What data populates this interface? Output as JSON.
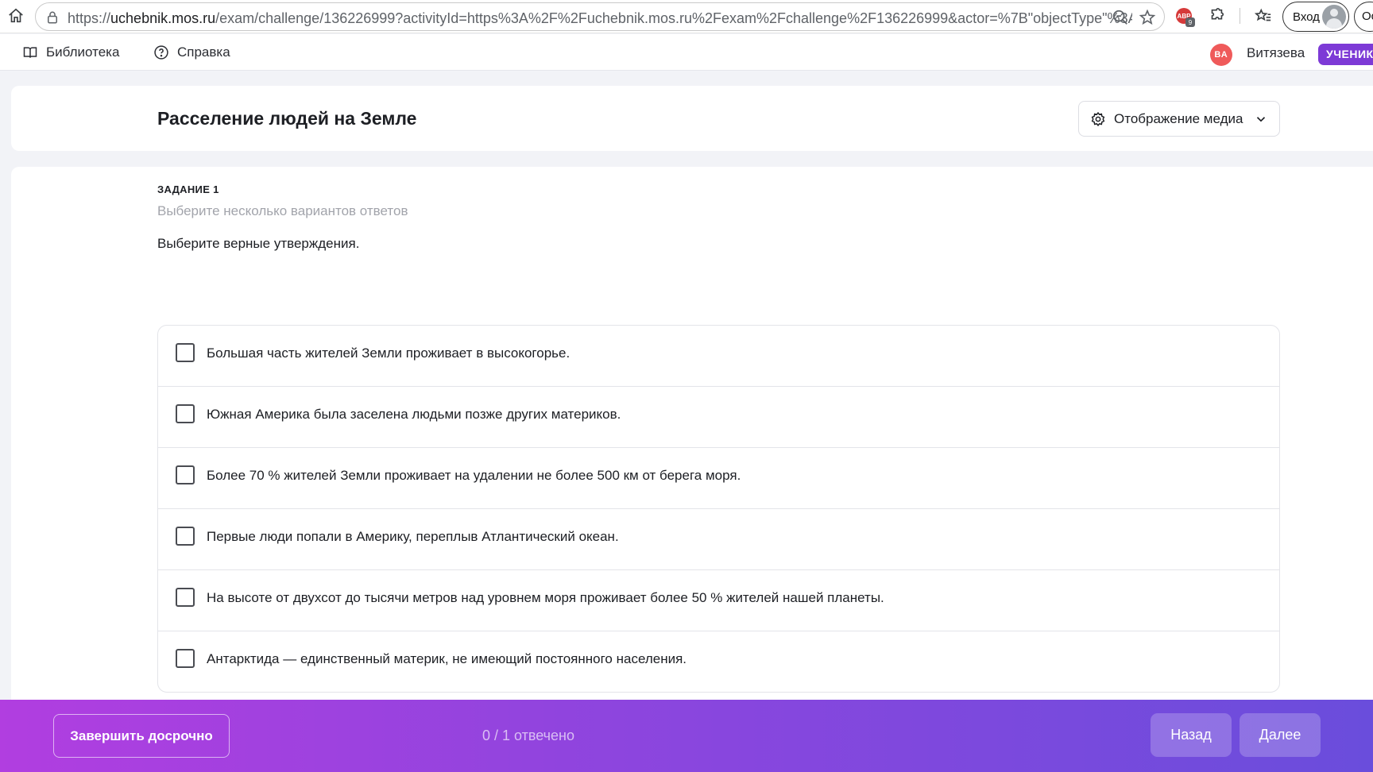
{
  "browser": {
    "url_prefix": "https://",
    "url_host": "uchebnik.mos.ru",
    "url_rest": "/exam/challenge/136226999?activityId=https%3A%2F%2Fuchebnik.mos.ru%2Fexam%2Fchallenge%2F136226999&actor=%7B\"objectType\"%3A...",
    "extension_badge_text": "ABP",
    "extension_badge_count": "9",
    "login_label": "Вход",
    "extra_label": "Ос"
  },
  "nav": {
    "library_label": "Библиотека",
    "help_label": "Справка",
    "user_initials": "ВА",
    "user_name": "Витязева",
    "role_badge": "УЧЕНИК"
  },
  "header": {
    "title": "Расселение людей на Земле",
    "media_button_label": "Отображение медиа"
  },
  "task": {
    "number_label": "ЗАДАНИЕ 1",
    "hint": "Выберите несколько вариантов ответов",
    "question": "Выберите верные утверждения.",
    "options": [
      {
        "label": "Большая часть жителей Земли проживает в высокогорье.",
        "checked": false
      },
      {
        "label": "Южная Америка была заселена людьми позже других материков.",
        "checked": false
      },
      {
        "label": "Более 70 % жителей Земли проживает на удалении не более 500 км от берега моря.",
        "checked": false
      },
      {
        "label": "Первые люди попали в Америку, переплыв Атлантический океан.",
        "checked": false
      },
      {
        "label": "На высоте от двухсот до тысячи метров над уровнем моря проживает более 50 % жителей нашей планеты.",
        "checked": false
      },
      {
        "label": "Антарктида — единственный материк, не имеющий постоянного населения.",
        "checked": false
      }
    ]
  },
  "footer": {
    "finish_label": "Завершить досрочно",
    "progress_text": "0 / 1 отвечено",
    "back_label": "Назад",
    "next_label": "Далее"
  },
  "colors": {
    "accent_purple": "#7d3ad6",
    "avatar_red": "#ef5a5a",
    "gradient_start": "#b13ee0",
    "gradient_end": "#6a4ddc"
  }
}
